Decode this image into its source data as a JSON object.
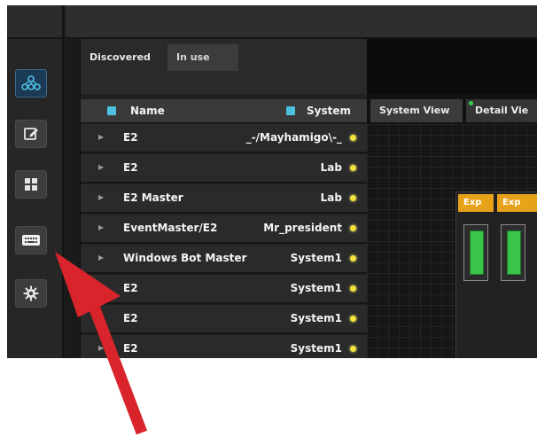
{
  "list_panel": {
    "tabs": [
      {
        "label": "Discovered",
        "selected": true
      },
      {
        "label": "In use",
        "selected": false
      }
    ],
    "columns": {
      "name": "Name",
      "system": "System"
    },
    "rows": [
      {
        "name": "E2",
        "system": "_-/Mayhamigo\\-_"
      },
      {
        "name": "E2",
        "system": "Lab"
      },
      {
        "name": "E2 Master",
        "system": "Lab"
      },
      {
        "name": "EventMaster/E2",
        "system": "Mr_president"
      },
      {
        "name": "Windows Bot Master",
        "system": "System1"
      },
      {
        "name": "E2",
        "system": "System1"
      },
      {
        "name": "E2",
        "system": "System1"
      },
      {
        "name": "E2",
        "system": "System1"
      }
    ]
  },
  "rail": {
    "items": [
      {
        "icon": "network-tree-icon",
        "active": true
      },
      {
        "icon": "edit-icon",
        "active": false
      },
      {
        "icon": "grid-icon",
        "active": false
      },
      {
        "icon": "keyboard-icon",
        "active": false
      },
      {
        "icon": "gear-icon",
        "active": false
      }
    ]
  },
  "main": {
    "view_tabs": [
      {
        "label": "System View"
      },
      {
        "label": "Detail Vie"
      }
    ],
    "device": {
      "expansion_labels": [
        "Exp",
        "Exp"
      ]
    }
  },
  "colors": {
    "accent_blue": "#4ec0e0",
    "status_dot": "#f2e23a",
    "exp_orange": "#e8a21a",
    "slot_green": "#39c44a",
    "annotation_arrow": "#d8242a"
  }
}
